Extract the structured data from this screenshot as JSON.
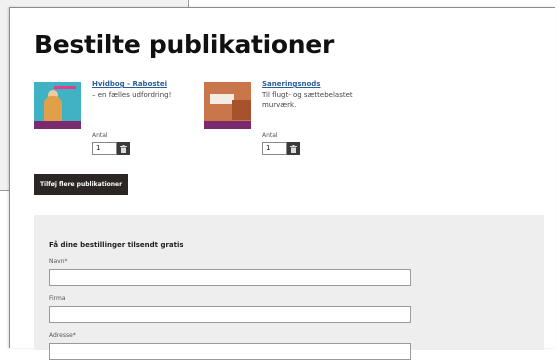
{
  "page_title": "Bestilte publikationer",
  "publications": [
    {
      "title": "Hvidbog - Rabostei",
      "subtitle": "– en fælles udfordring!",
      "qty_label": "Antal",
      "qty_value": "1",
      "cover_color": "#3fb3c3"
    },
    {
      "title": "Saneringsnods",
      "subtitle": "Til flugt- og sættebelastet murværk.",
      "qty_label": "Antal",
      "qty_value": "1",
      "cover_color": "#c8764a"
    }
  ],
  "add_button_label": "Tilføj flere publikationer",
  "form": {
    "heading": "Få dine bestillinger tilsendt gratis",
    "fields": [
      {
        "label": "Navn*",
        "value": ""
      },
      {
        "label": "Firma",
        "value": ""
      },
      {
        "label": "Adresse*",
        "value": ""
      }
    ]
  },
  "colors": {
    "link": "#2a5d9a",
    "button_bg": "#2b2523",
    "form_bg": "#eeeeee"
  }
}
